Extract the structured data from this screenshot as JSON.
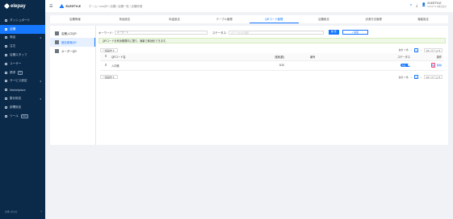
{
  "sidebar": {
    "logo": "elepay",
    "items": [
      {
        "label": "ダッシュボード",
        "icon": "dashboard-icon",
        "active": false
      },
      {
        "label": "店舗",
        "icon": "store-icon",
        "active": true
      },
      {
        "label": "商品",
        "icon": "product-icon",
        "active": false,
        "chevron": true
      },
      {
        "label": "注文",
        "icon": "order-icon",
        "active": false
      },
      {
        "label": "店舗スタッフ",
        "icon": "staff-icon",
        "active": false
      },
      {
        "label": "ユーザー",
        "icon": "user-icon",
        "active": false
      },
      {
        "label": "請求",
        "icon": "billing-icon",
        "active": false,
        "badge": "β"
      },
      {
        "label": "サービス設定",
        "icon": "service-icon",
        "active": false,
        "chevron": true
      },
      {
        "label": "Marketplace",
        "icon": "marketplace-icon",
        "active": false
      },
      {
        "label": "集計設定",
        "icon": "report-icon",
        "active": false,
        "chevron": true
      },
      {
        "label": "部署設定",
        "icon": "department-icon",
        "active": false
      },
      {
        "label": "ツール",
        "icon": "tool-icon",
        "active": false,
        "badge": "beta"
      }
    ],
    "footer": "お問い合わせ"
  },
  "header": {
    "shop_name": "ELESTYLE",
    "breadcrumb": "ホーム / onoQR / 店舗 / 店舗一覧 / 店舗詳細",
    "user_name": "ELESTYLE",
    "user_sub": "ELESTYLE株式会社"
  },
  "tabs": [
    "店舗情報",
    "商品設定",
    "料金設定",
    "テーブル管理",
    "QRコード管理",
    "店舗設定",
    "決済方法管理",
    "機能設定"
  ],
  "active_tab": 4,
  "subnav": [
    "店舗入口QR",
    "固定座席QR",
    "オーダーQR"
  ],
  "active_subnav": 1,
  "filters": {
    "keyword_label": "キーワード:",
    "keyword_placeholder": "キーワード",
    "status_label": "ステータス:",
    "status_placeholder": "ステータスを選択",
    "search_button": "検 索",
    "add_button": "+ 追加"
  },
  "notice": "QRコードを有効期限内に限り、廃棄で無効化できます。",
  "bulk_action": "一括操作",
  "pagination": {
    "total": "合計 1 件",
    "page": "1",
    "page_size": "10 / ページ"
  },
  "table": {
    "headers": [
      "QRコード名",
      "座席(数)",
      "番号",
      "ステータス",
      "操作"
    ],
    "rows": [
      {
        "name": "入口席",
        "seats": "0/10",
        "number": "",
        "status": "有効",
        "edit": "編",
        "delete": "削除"
      }
    ]
  },
  "colors": {
    "primary": "#1677ff",
    "sidebar": "#0b2a4a",
    "highlight": "#ff3b6b"
  }
}
